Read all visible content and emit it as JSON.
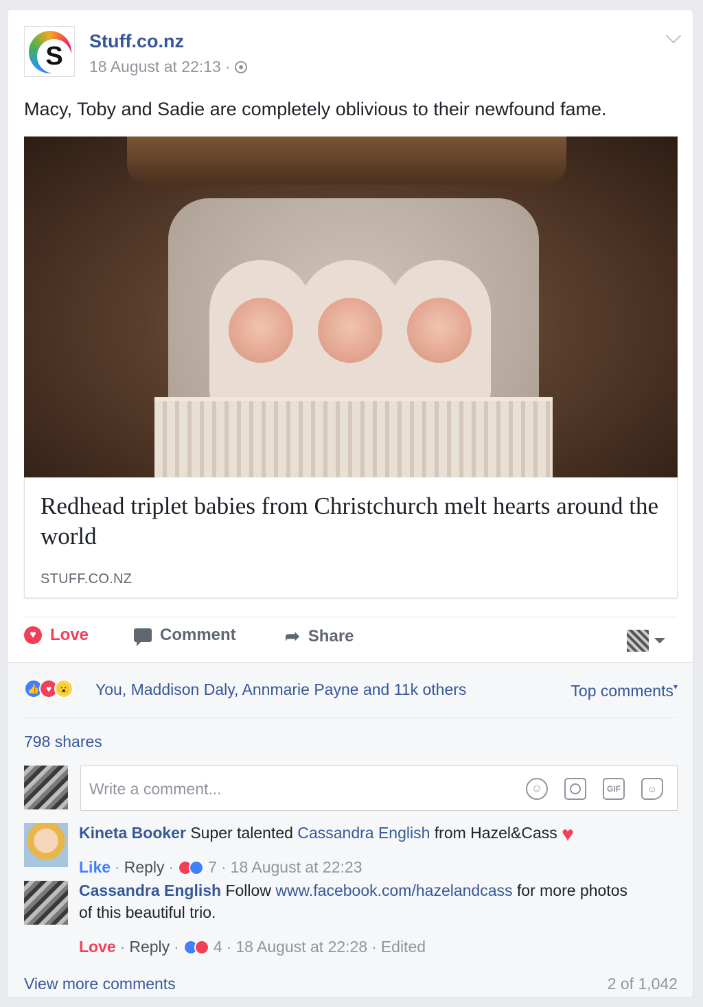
{
  "post": {
    "page_name": "Stuff.co.nz",
    "logo_letter": "S",
    "timestamp": "18 August at 22:13",
    "separator": "·",
    "text": "Macy, Toby and Sadie are completely oblivious to their newfound fame.",
    "privacy_icon": "globe-icon",
    "menu_icon": "chevron-down-icon"
  },
  "link": {
    "title": "Redhead triplet babies from Christchurch melt hearts around the world",
    "domain": "STUFF.CO.NZ"
  },
  "actions": {
    "love_label": "Love",
    "comment_label": "Comment",
    "share_label": "Share"
  },
  "reactions": {
    "summary": "You, Maddison Daly, Annmarie Payne and 11k others",
    "sort_label": "Top comments",
    "shares": "798 shares"
  },
  "composer": {
    "placeholder": "Write a comment...",
    "gif_label": "GIF"
  },
  "comments": [
    {
      "author": "Kineta Booker",
      "text_before": " Super talented ",
      "mention": "Cassandra English",
      "text_after": " from Hazel&Cass ",
      "emoji": "♥",
      "action": "Like",
      "reply": "Reply",
      "reaction_count": "7",
      "time": "18 August at 22:23"
    },
    {
      "author": "Cassandra English",
      "text_before": " Follow ",
      "link": "www.facebook.com/hazelandcass",
      "text_after": " for more photos of this beautiful trio.",
      "action": "Love",
      "reply": "Reply",
      "reaction_count": "4",
      "time": "18 August at 22:28",
      "edited": "Edited"
    }
  ],
  "footer": {
    "view_more": "View more comments",
    "count": "2 of 1,042"
  },
  "colors": {
    "link_blue": "#365899",
    "love_red": "#f33e58",
    "like_blue": "#4080ff",
    "muted": "#90949c"
  }
}
